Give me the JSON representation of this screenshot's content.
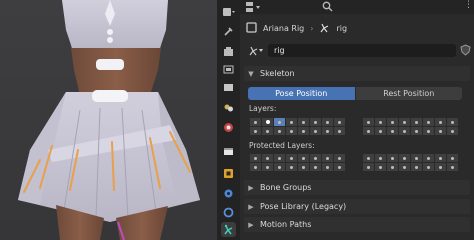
{
  "header": {
    "object_name": "Ariana Rig",
    "data_name": "rig",
    "field_value": "rig"
  },
  "skeleton": {
    "title": "Skeleton",
    "pose_position": "Pose Position",
    "rest_position": "Rest Position",
    "layers_label": "Layers:",
    "protected_label": "Protected Layers:"
  },
  "sections": {
    "bone_groups": "Bone Groups",
    "pose_library": "Pose Library (Legacy)",
    "motion_paths": "Motion Paths"
  },
  "colors": {
    "accent": "#4772b3",
    "skirt": "#c9c6d6",
    "stripe": "#e8a04a"
  }
}
